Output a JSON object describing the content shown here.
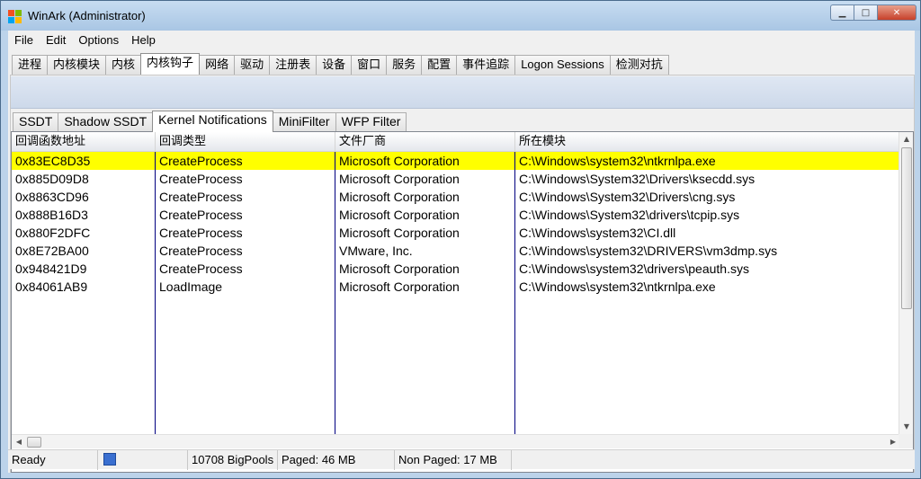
{
  "window": {
    "title": "WinArk (Administrator)",
    "caption_minimize": "▁",
    "caption_maximize": "□",
    "caption_close": "✕"
  },
  "menu": {
    "items": [
      "File",
      "Edit",
      "Options",
      "Help"
    ]
  },
  "main_tabs": {
    "items": [
      "进程",
      "内核模块",
      "内核",
      "内核钩子",
      "网络",
      "驱动",
      "注册表",
      "设备",
      "窗口",
      "服务",
      "配置",
      "事件追踪",
      "Logon Sessions",
      "检测对抗"
    ],
    "active_index": 3
  },
  "sub_tabs": {
    "items": [
      "SSDT",
      "Shadow SSDT",
      "Kernel Notifications",
      "MiniFilter",
      "WFP Filter"
    ],
    "active_index": 2
  },
  "table": {
    "columns": [
      "回调函数地址",
      "回调类型",
      "文件厂商",
      "所在模块"
    ],
    "rows": [
      {
        "address": "0x83EC8D35",
        "type": "CreateProcess",
        "vendor": "Microsoft Corporation",
        "module": "C:\\Windows\\system32\\ntkrnlpa.exe"
      },
      {
        "address": "0x885D09D8",
        "type": "CreateProcess",
        "vendor": "Microsoft Corporation",
        "module": "C:\\Windows\\System32\\Drivers\\ksecdd.sys"
      },
      {
        "address": "0x8863CD96",
        "type": "CreateProcess",
        "vendor": "Microsoft Corporation",
        "module": "C:\\Windows\\System32\\Drivers\\cng.sys"
      },
      {
        "address": "0x888B16D3",
        "type": "CreateProcess",
        "vendor": "Microsoft Corporation",
        "module": "C:\\Windows\\System32\\drivers\\tcpip.sys"
      },
      {
        "address": "0x880F2DFC",
        "type": "CreateProcess",
        "vendor": "Microsoft Corporation",
        "module": "C:\\Windows\\system32\\CI.dll"
      },
      {
        "address": "0x8E72BA00",
        "type": "CreateProcess",
        "vendor": "VMware, Inc.",
        "module": "C:\\Windows\\system32\\DRIVERS\\vm3dmp.sys"
      },
      {
        "address": "0x948421D9",
        "type": "CreateProcess",
        "vendor": "Microsoft Corporation",
        "module": "C:\\Windows\\system32\\drivers\\peauth.sys"
      },
      {
        "address": "0x84061AB9",
        "type": "LoadImage",
        "vendor": "Microsoft Corporation",
        "module": "C:\\Windows\\system32\\ntkrnlpa.exe"
      }
    ],
    "selected_index": 0,
    "selected_color": "#ffff00"
  },
  "status": {
    "ready": "Ready",
    "bigpools": "10708 BigPools",
    "paged": "Paged: 46 MB",
    "nonpaged": "Non Paged: 17 MB"
  },
  "colors": {
    "title_bg": "#bcd3ea",
    "column_divider": "#000080",
    "status_indicator": "#3a6fd0"
  }
}
